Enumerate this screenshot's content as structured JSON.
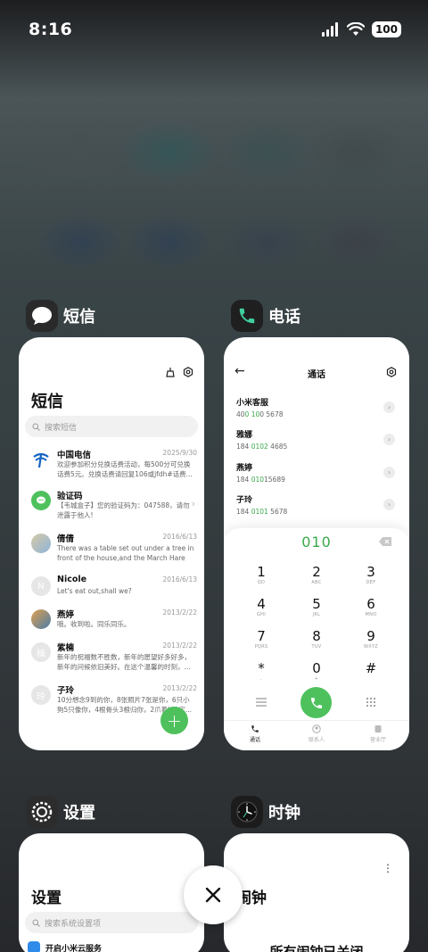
{
  "status_bar": {
    "time": "8:16",
    "battery": "100"
  },
  "sms_app": {
    "name": "短信",
    "title": "短信",
    "search_placeholder": "搜索短信",
    "messages": [
      {
        "name": "中国电信",
        "date": "2025/9/30",
        "preview": "欢迎参加积分兑换话费活动，每500分可兑换话费5元。兑换话费请回复106或jfdh#话费...",
        "avatar": ""
      },
      {
        "name": "验证码",
        "date": "",
        "preview": "【韦城盒子】您的验证码为：047588，请勿泄露于他人!",
        "avatar": ""
      },
      {
        "name": "倩倩",
        "date": "2016/6/13",
        "preview": "There was a table set out under a tree in front of the house,and the March Hare an...",
        "avatar": ""
      },
      {
        "name": "Nicole",
        "date": "2016/6/13",
        "preview": "Let's eat out,shall we?",
        "avatar": "N"
      },
      {
        "name": "燕婷",
        "date": "2013/2/22",
        "preview": "哦。收到啦。同乐同乐。",
        "avatar": ""
      },
      {
        "name": "紫楠",
        "date": "2013/2/22",
        "preview": "新年的祝福数不胜数，新年的愿望好多好多，新年的问候依旧美好。在这个温馨的时刻，...",
        "avatar": "楠"
      },
      {
        "name": "子玲",
        "date": "2013/2/22",
        "preview": "10分想念9到的你，8张照片7张是你，6只小狗5只像你，4根骨头3根归你，2爪着她1定...",
        "avatar": "玲"
      }
    ],
    "fab_label": "+"
  },
  "phone_app": {
    "name": "电话",
    "title": "通话",
    "contacts": [
      {
        "name": "小米客服",
        "num_pre": "40",
        "num_hl": "0 10",
        "num_post": "0 5678"
      },
      {
        "name": "雅娜",
        "num_pre": "184 ",
        "num_hl": "0102",
        "num_post": " 4685"
      },
      {
        "name": "燕婷",
        "num_pre": "184 ",
        "num_hl": "010",
        "num_post": "15689"
      },
      {
        "name": "子玲",
        "num_pre": "184 ",
        "num_hl": "0101",
        "num_post": " 5678"
      }
    ],
    "dialed": "010",
    "keys": [
      {
        "d": "1",
        "l": "QD"
      },
      {
        "d": "2",
        "l": "ABC"
      },
      {
        "d": "3",
        "l": "DEF"
      },
      {
        "d": "4",
        "l": "GHI"
      },
      {
        "d": "5",
        "l": "JKL"
      },
      {
        "d": "6",
        "l": "MNO"
      },
      {
        "d": "7",
        "l": "PQRS"
      },
      {
        "d": "8",
        "l": "TUV"
      },
      {
        "d": "9",
        "l": "WXYZ"
      },
      {
        "d": "*",
        "l": ","
      },
      {
        "d": "0",
        "l": "+"
      },
      {
        "d": "#",
        "l": ""
      }
    ],
    "tabs": [
      "通话",
      "联系人",
      "营业厅"
    ]
  },
  "settings_app": {
    "name": "设置",
    "title": "设置",
    "search_placeholder": "搜索系统设置项",
    "first_row": "开启小米云服务"
  },
  "clock_app": {
    "name": "时钟",
    "title": "闹钟",
    "status": "所有闹钟已关闭"
  },
  "colors": {
    "accent_green": "#4ec15d",
    "highlight_green": "#39a94a"
  }
}
